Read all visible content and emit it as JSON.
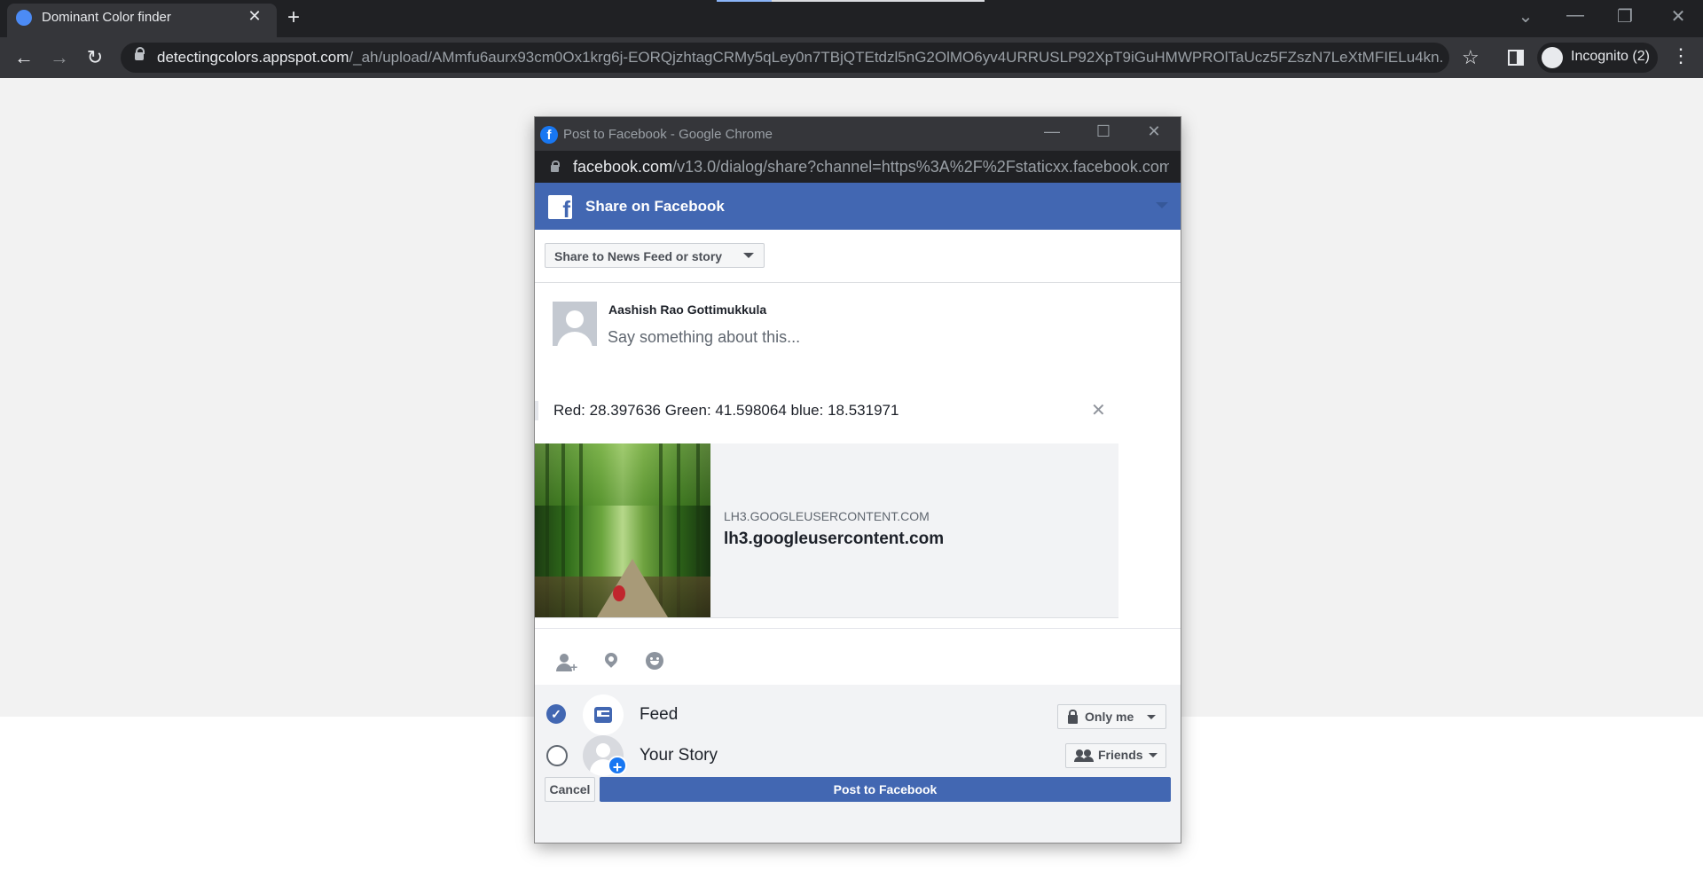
{
  "browser": {
    "tab_title": "Dominant Color finder",
    "url_host": "detectingcolors.appspot.com",
    "url_path": "/_ah/upload/AMmfu6aurx93cm0Ox1krg6j-EORQjzhtagCRMy5qLey0n7TBjQTEtdzl5nG2OlMO6yv4URRUSLP92XpT9iGuHMWPROlTaUcz5FZszN7LeXtMFIELu4kn...",
    "incognito_label": "Incognito (2)"
  },
  "popup": {
    "window_title": "Post to Facebook - Google Chrome",
    "url_host": "facebook.com",
    "url_path": "/v13.0/dialog/share?channel=https%3A%2F%2Fstaticxx.facebook.com...",
    "header_title": "Share on Facebook",
    "share_target": "Share to News Feed or story",
    "user_name": "Aashish Rao Gottimukkula",
    "composer_placeholder": "Say something about this...",
    "quote_text": "Red: 28.397636 Green: 41.598064 blue: 18.531971",
    "preview": {
      "domain": "LH3.GOOGLEUSERCONTENT.COM",
      "title": "lh3.googleusercontent.com"
    },
    "destinations": [
      {
        "label": "Feed",
        "privacy": "Only me",
        "checked": true
      },
      {
        "label": "Your Story",
        "privacy": "Friends",
        "checked": false
      }
    ],
    "cancel_label": "Cancel",
    "post_label": "Post to Facebook"
  },
  "colors": {
    "facebook_blue": "#4267b2",
    "chrome_dark": "#35363a"
  },
  "icons": [
    "chrome-favicon",
    "close-icon",
    "new-tab-icon",
    "back-icon",
    "forward-icon",
    "reload-icon",
    "lock-icon",
    "star-icon",
    "side-panel-icon",
    "incognito-icon",
    "menu-icon",
    "facebook-icon",
    "tag-friends-icon",
    "location-icon",
    "feeling-icon",
    "checkmark-icon",
    "feed-icon",
    "plus-icon",
    "friends-icon"
  ]
}
